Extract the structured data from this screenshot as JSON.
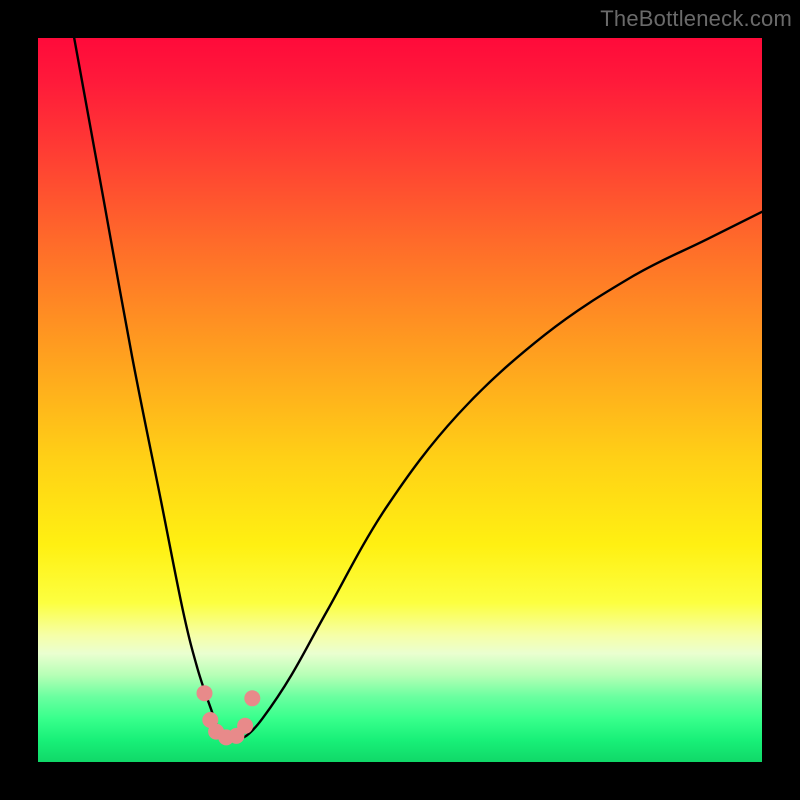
{
  "watermark": "TheBottleneck.com",
  "colors": {
    "frame": "#000000",
    "curve": "#000000",
    "marker_fill": "#e88a8a",
    "marker_stroke": "#d86a6a",
    "gradient_stops": [
      "#ff0a3a",
      "#ff1a3a",
      "#ff3a34",
      "#ff6a2a",
      "#ff9a20",
      "#ffd016",
      "#fff012",
      "#fcff40",
      "#f6ffa8",
      "#eaffd0",
      "#b6ffb6",
      "#6affa0",
      "#38ff8c",
      "#18f078",
      "#10d868"
    ]
  },
  "chart_data": {
    "type": "line",
    "title": "",
    "xlabel": "",
    "ylabel": "",
    "xlim": [
      0,
      100
    ],
    "ylim": [
      0,
      100
    ],
    "grid": false,
    "legend": false,
    "series": [
      {
        "name": "bottleneck-curve",
        "description": "V-shaped bottleneck curve; two asymptotic branches meet at a narrow minimum around x≈25",
        "x": [
          5,
          9,
          13,
          17,
          20,
          22,
          24,
          25,
          26,
          27,
          28,
          29,
          31,
          35,
          40,
          48,
          58,
          70,
          82,
          92,
          100
        ],
        "y": [
          100,
          78,
          56,
          36,
          21,
          13,
          7,
          4.5,
          3.5,
          3.2,
          3.3,
          3.8,
          6,
          12,
          21,
          35,
          48,
          59,
          67,
          72,
          76
        ]
      }
    ],
    "markers": [
      {
        "x": 23.0,
        "y": 9.5,
        "r": 8
      },
      {
        "x": 23.8,
        "y": 5.8,
        "r": 8
      },
      {
        "x": 24.6,
        "y": 4.2,
        "r": 8
      },
      {
        "x": 26.0,
        "y": 3.4,
        "r": 8
      },
      {
        "x": 27.4,
        "y": 3.6,
        "r": 8
      },
      {
        "x": 28.6,
        "y": 5.0,
        "r": 8
      },
      {
        "x": 29.6,
        "y": 8.8,
        "r": 8
      }
    ]
  }
}
